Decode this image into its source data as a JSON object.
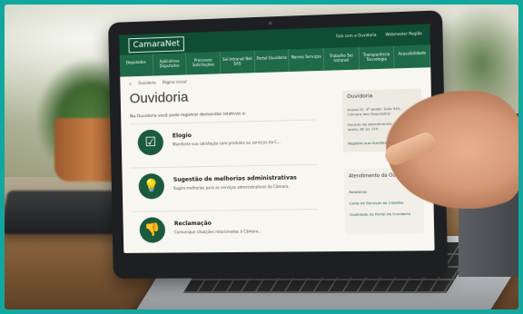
{
  "site": {
    "logo_text": "CamaraNet",
    "top_links": [
      "Fale com a Ouvidoria",
      "Webmaster Região"
    ]
  },
  "nav": {
    "items": [
      "Deputados",
      "Aplicativos Deputados",
      "Processos Solicitações",
      "Sei Intranet Net SAS",
      "Portal Ouvidoria",
      "Norma Serviços",
      "Trabalho Sei Intranet",
      "Transparência Tecnologia",
      "Acessibilidade"
    ]
  },
  "breadcrumb": [
    "Ouvidoria",
    "Página inicial"
  ],
  "page": {
    "title": "Ouvidoria",
    "intro": "Na Ouvidoria você pode registrar demandas relativas a:"
  },
  "cards": [
    {
      "title": "Elogio",
      "desc": "Manifeste sua satisfação com produtos ou serviços da C..."
    },
    {
      "title": "Sugestão de melhorias administrativas",
      "desc": "Sugira melhorias para os serviços administrativos da Câmara."
    },
    {
      "title": "Reclamação",
      "desc": "Comunique situações relacionadas à Câmara..."
    }
  ],
  "sidebar": {
    "ouvidoria_heading": "Ouvidoria",
    "contact_text": "Anexo IV, 4º andar, Sala 540, Câmara dos Deputados",
    "hours_text": "Horário de atendimento: segunda a sexta, 8h às 12h",
    "link": "Registre sua manifestação",
    "service_heading": "Atendimento da Ouvidoria",
    "service_links": [
      "Relatórios",
      "Carta de Serviços ao Cidadão",
      "Qualidade do Portal da Ouvidoria"
    ]
  },
  "icons": {
    "elogio": "check-box-icon",
    "sugestao": "lightbulb-icon",
    "reclamacao": "thumbs-down-icon"
  },
  "colors": {
    "header_green": "#0f4d34",
    "nav_green": "#1f6a47",
    "icon_green": "#1b5a3c",
    "frame_teal": "#12a79e"
  }
}
